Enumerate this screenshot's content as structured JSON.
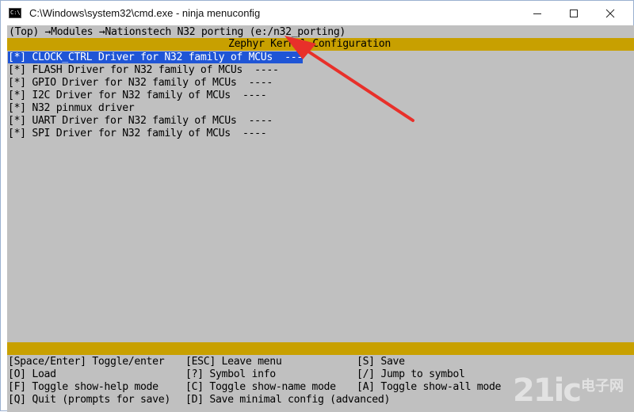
{
  "window": {
    "title": "C:\\Windows\\system32\\cmd.exe - ninja  menuconfig",
    "icon": "C:\\",
    "buttons": {
      "minimize": "minimize-icon",
      "maximize": "maximize-icon",
      "close": "close-icon"
    }
  },
  "breadcrumb": "(Top) →Modules →Nationstech N32 porting (e:/n32_porting)",
  "header_title": "Zephyr Kernel Configuration",
  "menu_items": [
    {
      "check": "[*] ",
      "label": "CLOCK_CTRL Driver for N32 family of MCUs  ---",
      "selected": true
    },
    {
      "check": "[*] ",
      "label": "FLASH Driver for N32 family of MCUs  ----",
      "selected": false
    },
    {
      "check": "[*] ",
      "label": "GPIO Driver for N32 family of MCUs  ----",
      "selected": false
    },
    {
      "check": "[*] ",
      "label": "I2C Driver for N32 family of MCUs  ----",
      "selected": false
    },
    {
      "check": "[*] ",
      "label": "N32 pinmux driver",
      "selected": false
    },
    {
      "check": "[*] ",
      "label": "UART Driver for N32 family of MCUs  ----",
      "selected": false
    },
    {
      "check": "[*] ",
      "label": "SPI Driver for N32 family of MCUs  ----",
      "selected": false
    }
  ],
  "key_help": [
    [
      "[Space/Enter] Toggle/enter",
      "[ESC] Leave menu",
      "[S] Save"
    ],
    [
      "[O] Load",
      "[?] Symbol info",
      "[/] Jump to symbol"
    ],
    [
      "[F] Toggle show-help mode",
      "[C] Toggle show-name mode",
      "[A] Toggle show-all mode"
    ],
    [
      "[Q] Quit (prompts for save)",
      "[D] Save minimal config (advanced)",
      ""
    ]
  ],
  "watermark": {
    "text": "21ic",
    "cn": "电子网"
  },
  "colors": {
    "console_bg": "#c0c0c0",
    "bar": "#c8a000",
    "selection": "#1f55d6",
    "arrow": "#e8302a"
  }
}
